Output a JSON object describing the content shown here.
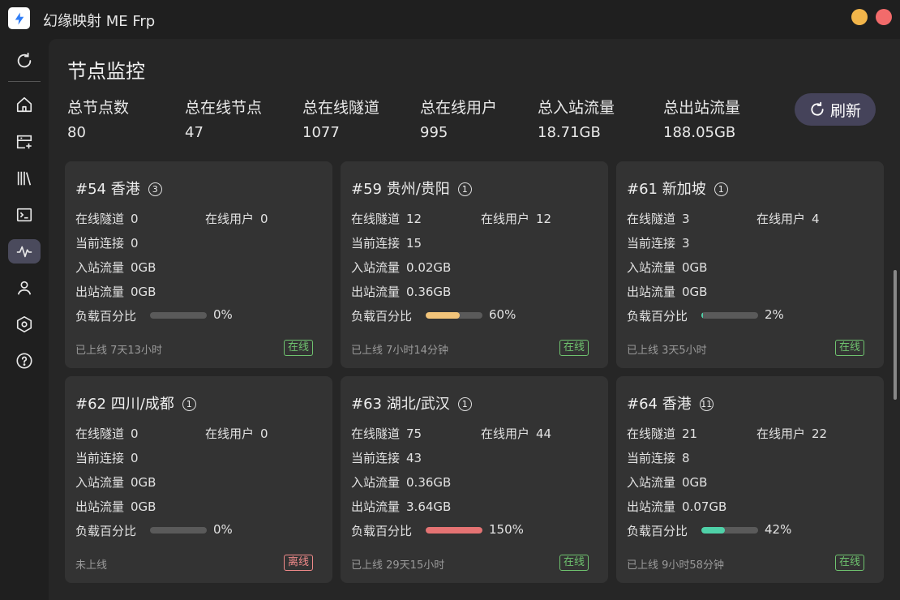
{
  "app": {
    "title": "幻缘映射 ME Frp"
  },
  "sidebar": {
    "items": [
      {
        "icon": "sync-icon"
      },
      {
        "icon": "home-icon"
      },
      {
        "icon": "tunnel-add-icon"
      },
      {
        "icon": "library-icon"
      },
      {
        "icon": "terminal-icon"
      },
      {
        "icon": "monitor-icon",
        "active": true
      },
      {
        "icon": "user-icon"
      },
      {
        "icon": "settings-hex-icon"
      },
      {
        "icon": "help-icon"
      }
    ]
  },
  "page": {
    "title": "节点监控"
  },
  "stats": [
    {
      "label": "总节点数",
      "value": "80"
    },
    {
      "label": "总在线节点",
      "value": "47"
    },
    {
      "label": "总在线隧道",
      "value": "1077"
    },
    {
      "label": "总在线用户",
      "value": "995"
    },
    {
      "label": "总入站流量",
      "value": "18.71GB"
    },
    {
      "label": "总出站流量",
      "value": "188.05GB"
    }
  ],
  "refresh_label": "刷新",
  "labels": {
    "tunnels": "在线隧道",
    "users": "在线用户",
    "connections": "当前连接",
    "inbound": "入站流量",
    "outbound": "出站流量",
    "load": "负载百分比"
  },
  "colors": {
    "load_low": "#4fd1a8",
    "load_mid": "#f2c47a",
    "load_high": "#e57373",
    "online": "#6fc36f",
    "offline": "#f08a8a"
  },
  "nodes": [
    {
      "title": "#54 香港",
      "badge_num": "3",
      "tunnels": "0",
      "users": "0",
      "connections": "0",
      "inbound": "0GB",
      "outbound": "0GB",
      "load": "0%",
      "load_value": 0,
      "uptime": "已上线 7天13小时",
      "status": "在线",
      "online": true
    },
    {
      "title": "#59 贵州/贵阳",
      "badge_num": "1",
      "tunnels": "12",
      "users": "12",
      "connections": "15",
      "inbound": "0.02GB",
      "outbound": "0.36GB",
      "load": "60%",
      "load_value": 60,
      "uptime": "已上线 7小时14分钟",
      "status": "在线",
      "online": true
    },
    {
      "title": "#61 新加坡",
      "badge_num": "1",
      "tunnels": "3",
      "users": "4",
      "connections": "3",
      "inbound": "0GB",
      "outbound": "0GB",
      "load": "2%",
      "load_value": 2,
      "uptime": "已上线 3天5小时",
      "status": "在线",
      "online": true
    },
    {
      "title": "#62 四川/成都",
      "badge_num": "1",
      "tunnels": "0",
      "users": "0",
      "connections": "0",
      "inbound": "0GB",
      "outbound": "0GB",
      "load": "0%",
      "load_value": 0,
      "uptime": "未上线",
      "status": "离线",
      "online": false
    },
    {
      "title": "#63 湖北/武汉",
      "badge_num": "1",
      "tunnels": "75",
      "users": "44",
      "connections": "43",
      "inbound": "0.36GB",
      "outbound": "3.64GB",
      "load": "150%",
      "load_value": 150,
      "uptime": "已上线 29天15小时",
      "status": "在线",
      "online": true
    },
    {
      "title": "#64 香港",
      "badge_num": "11",
      "tunnels": "21",
      "users": "22",
      "connections": "8",
      "inbound": "0GB",
      "outbound": "0.07GB",
      "load": "42%",
      "load_value": 42,
      "uptime": "已上线 9小时58分钟",
      "status": "在线",
      "online": true
    }
  ]
}
